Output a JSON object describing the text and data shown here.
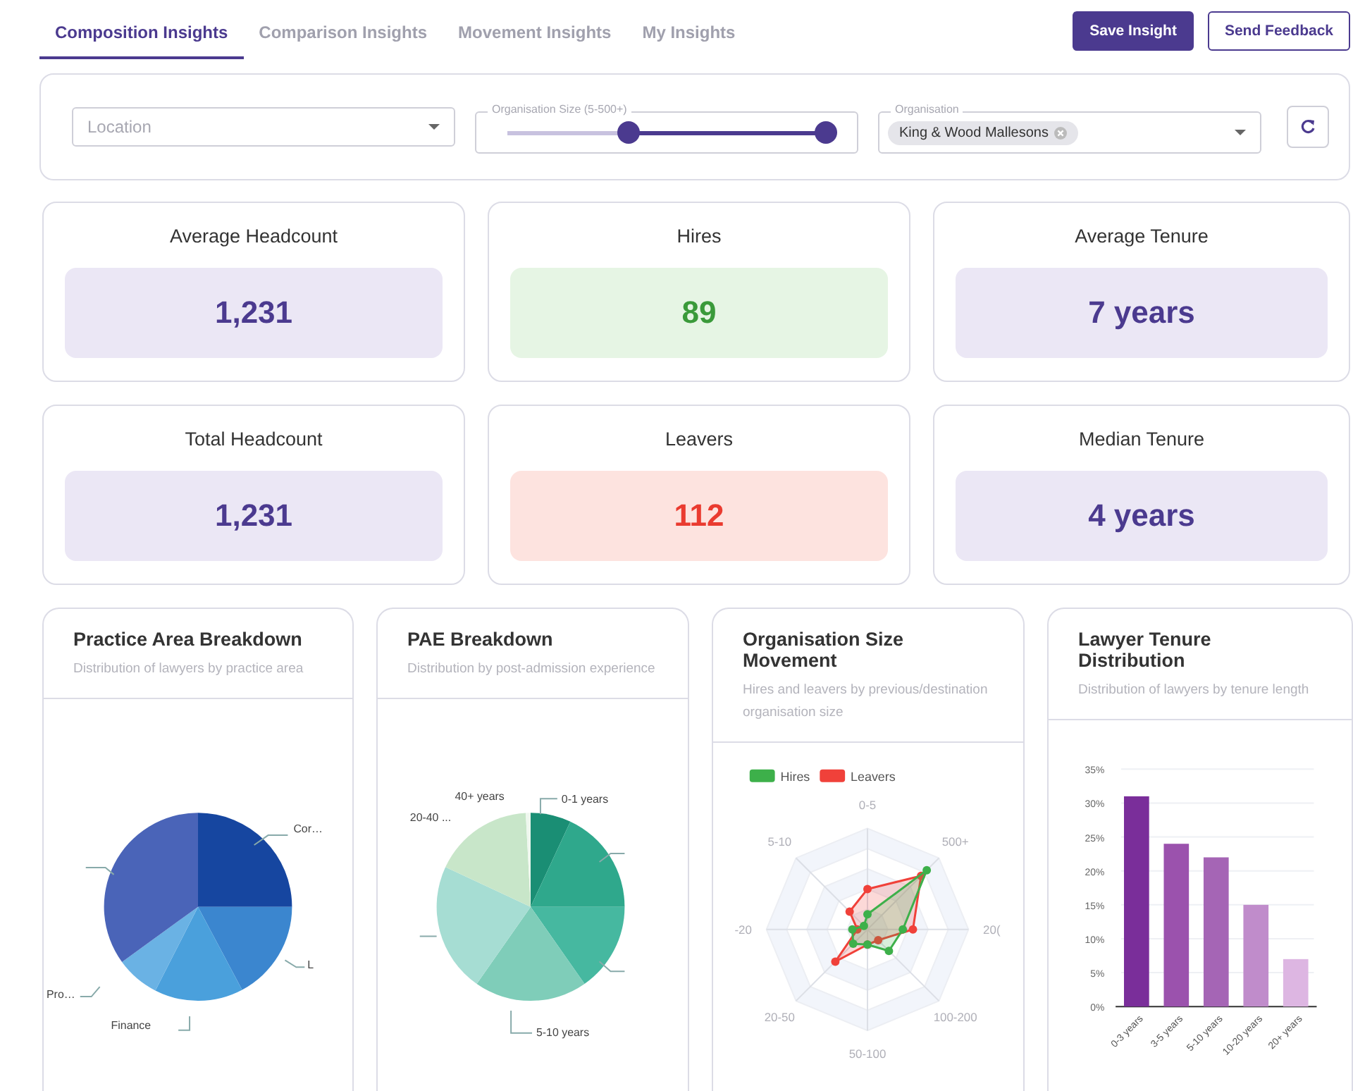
{
  "tabs": [
    {
      "label": "Composition Insights",
      "selected": true
    },
    {
      "label": "Comparison Insights",
      "selected": false
    },
    {
      "label": "Movement Insights",
      "selected": false
    },
    {
      "label": "My Insights",
      "selected": false
    }
  ],
  "actions": [
    {
      "label": "Save Insight",
      "kind": "primary"
    },
    {
      "label": "Send Feedback",
      "kind": "outline"
    }
  ],
  "filters": {
    "location": {
      "placeholder": "Location"
    },
    "size_slider": {
      "label": "Organisation Size (5-500+)",
      "thumbs": [
        {
          "level": 0.38
        },
        {
          "level": 1
        }
      ]
    },
    "organisation": {
      "label": "Organisation",
      "chips": [
        "King & Wood Mallesons"
      ]
    }
  },
  "stats": [
    {
      "label": "Average Headcount",
      "value": "1,231",
      "kind": "neutral"
    },
    {
      "label": "Hires",
      "value": "89",
      "kind": "positive"
    },
    {
      "label": "Average Tenure",
      "value": "7 years",
      "kind": "neutral"
    },
    {
      "label": "Total Headcount",
      "value": "1,231",
      "kind": "neutral"
    },
    {
      "label": "Leavers",
      "value": "112",
      "kind": "negative"
    },
    {
      "label": "Median Tenure",
      "value": "4 years",
      "kind": "neutral"
    }
  ],
  "charts": [
    {
      "kind": "pie",
      "title": "Practice Area Breakdown",
      "subtitle": "Distribution of lawyers by practice area",
      "labels": [
        "Cor…",
        "L",
        "Finance",
        "Pro…"
      ]
    },
    {
      "kind": "pie2",
      "title": "PAE Breakdown",
      "subtitle": "Distribution by post-admission experience",
      "labels": [
        "0-1 years",
        "5-10 years",
        "20-40 ...",
        "40+ years"
      ]
    },
    {
      "kind": "radar",
      "title": "Organisation Size Movement",
      "subtitle": "Hires and leavers by previous/destination organisation size",
      "legend": [
        {
          "label": "Hires",
          "color": "#3db04a"
        },
        {
          "label": "Leavers",
          "color": "#f0413a"
        }
      ],
      "axes": [
        "0-5",
        "500+",
        "20(",
        "100-200",
        "50-100",
        "20-50",
        "-20",
        "5-10"
      ]
    },
    {
      "kind": "bar",
      "title": "Lawyer Tenure Distribution",
      "subtitle": "Distribution of lawyers by tenure length",
      "chart_data": {
        "type": "bar",
        "categories": [
          "0-3 years",
          "3-5 years",
          "5-10 years",
          "10-20 years",
          "20+ years"
        ],
        "values": [
          31,
          24,
          22,
          15,
          7
        ],
        "ylim": [
          0,
          35
        ],
        "grid": true,
        "yticks": [
          {
            "value": 0,
            "label": "0%"
          },
          {
            "value": 5,
            "label": "5%"
          },
          {
            "value": 10,
            "label": "10%"
          },
          {
            "value": 15,
            "label": "15%"
          },
          {
            "value": 20,
            "label": "20%"
          },
          {
            "value": 25,
            "label": "25%"
          },
          {
            "value": 30,
            "label": "30%"
          },
          {
            "value": 35,
            "label": "35%"
          }
        ]
      }
    }
  ]
}
